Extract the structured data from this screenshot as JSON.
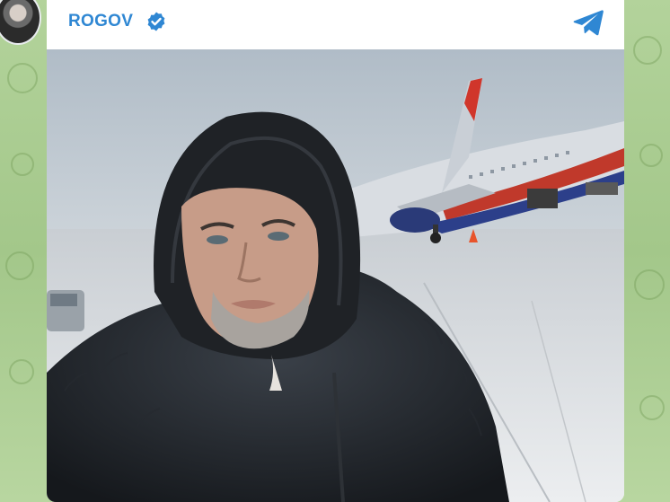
{
  "channel": {
    "name": "ROGOV",
    "verified": true,
    "verified_icon": "verified-badge-icon",
    "share_icon": "telegram-share-icon",
    "accent": "#2f87d3"
  },
  "post": {
    "photo_subject": "photo",
    "wallpaper_color": "#a9c98e"
  }
}
